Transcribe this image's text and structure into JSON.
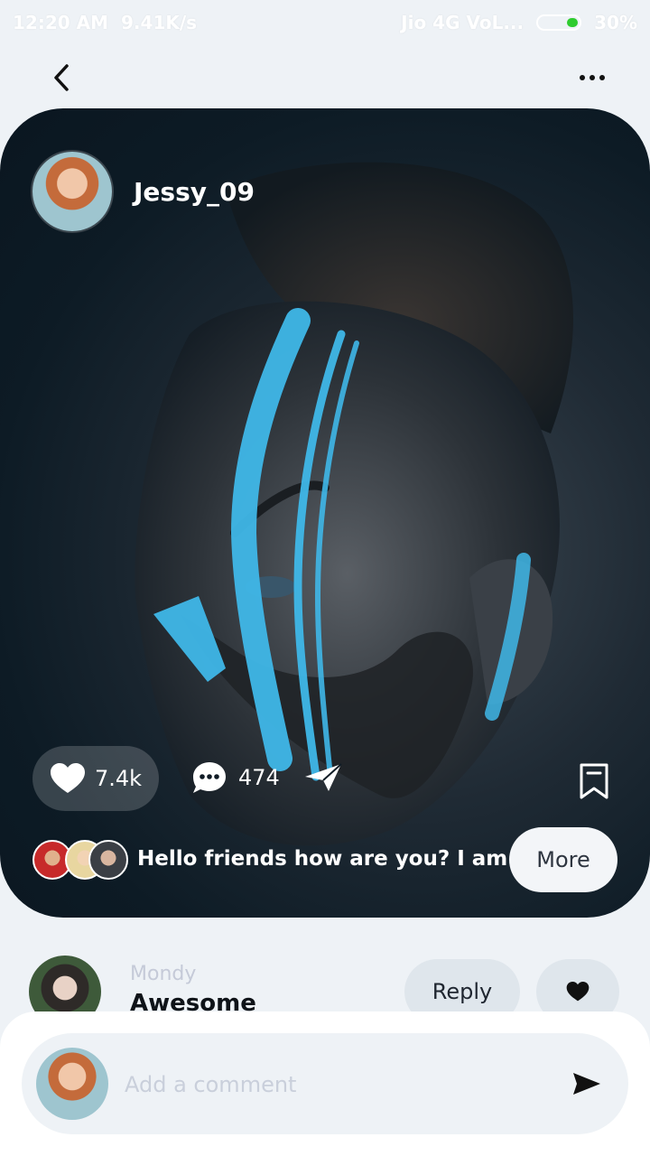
{
  "status_bar": {
    "time": "12:20 AM",
    "net_speed": "9.41K/s",
    "carrier": "Jio 4G VoL...",
    "battery": "30%"
  },
  "post": {
    "author": "Jessy_09",
    "likes": "7.4k",
    "comments": "474",
    "caption": "Hello friends how are you? I am ...",
    "more_label": "More"
  },
  "comment": {
    "user": "Mondy",
    "text": "Awesome",
    "reply_label": "Reply"
  },
  "composer": {
    "placeholder": "Add a comment"
  },
  "colors": {
    "background": "#eef2f6",
    "card_dark": "#0d1b25",
    "accent_paint": "#3fb7e8"
  },
  "icons": [
    "back-icon",
    "more-dots-icon",
    "heart-icon",
    "comment-icon",
    "send-icon",
    "bookmark-icon"
  ]
}
